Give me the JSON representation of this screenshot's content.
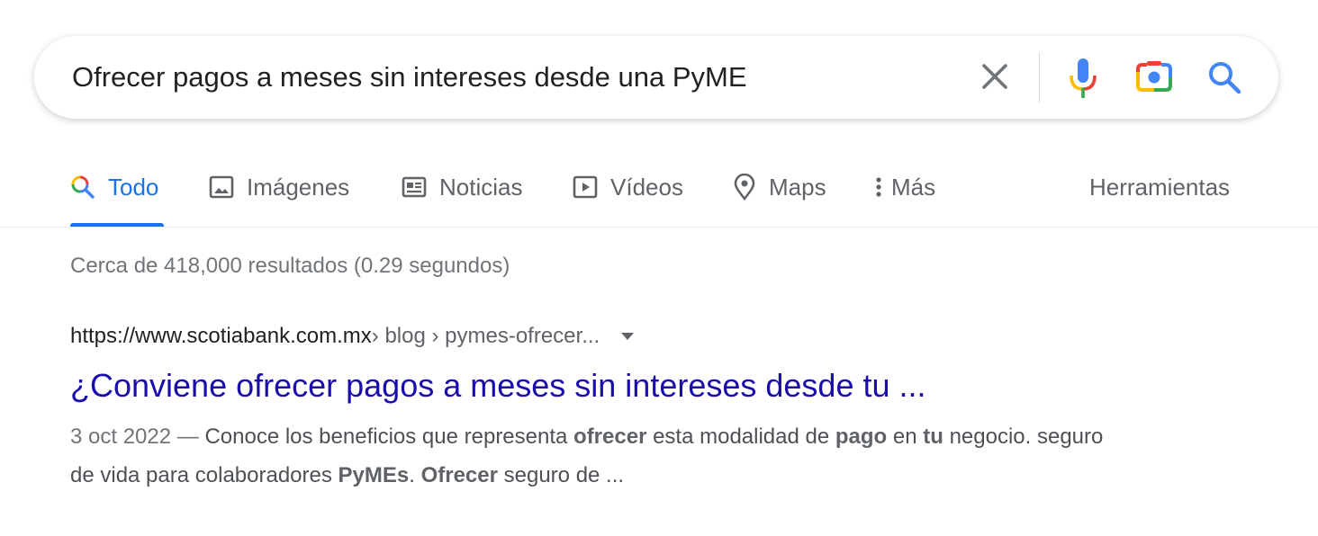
{
  "search": {
    "query": "Ofrecer pagos a meses sin intereses desde una PyME",
    "icons": [
      "close-icon",
      "mic-icon",
      "camera-icon",
      "search-icon"
    ]
  },
  "tabs": [
    {
      "label": "Todo",
      "icon": "search-icon",
      "active": true
    },
    {
      "label": "Imágenes",
      "icon": "image-icon"
    },
    {
      "label": "Noticias",
      "icon": "news-icon"
    },
    {
      "label": "Vídeos",
      "icon": "play-icon"
    },
    {
      "label": "Maps",
      "icon": "map-pin-icon"
    },
    {
      "label": "Más",
      "icon": "more-vert-icon"
    }
  ],
  "tools_label": "Herramientas",
  "stats": "Cerca de 418,000 resultados (0.29 segundos)",
  "result": {
    "domain": "https://www.scotiabank.com.mx",
    "path": " › blog › pymes-ofrecer...",
    "title": "¿Conviene ofrecer pagos a meses sin intereses desde tu ...",
    "date": "3 oct 2022 — ",
    "snippet": [
      {
        "t": "Conoce los beneficios que representa ",
        "b": false
      },
      {
        "t": "ofrecer",
        "b": true
      },
      {
        "t": " esta modalidad de ",
        "b": false
      },
      {
        "t": "pago",
        "b": true
      },
      {
        "t": " en ",
        "b": false
      },
      {
        "t": "tu",
        "b": true
      },
      {
        "t": " negocio. seguro de vida para colaboradores ",
        "b": false
      },
      {
        "t": "PyMEs",
        "b": true
      },
      {
        "t": ". ",
        "b": false
      },
      {
        "t": "Ofrecer",
        "b": true
      },
      {
        "t": " seguro de ...",
        "b": false
      }
    ]
  },
  "colors": {
    "accent": "#1a73e8",
    "link": "#1a0dab",
    "muted": "#70757a"
  }
}
